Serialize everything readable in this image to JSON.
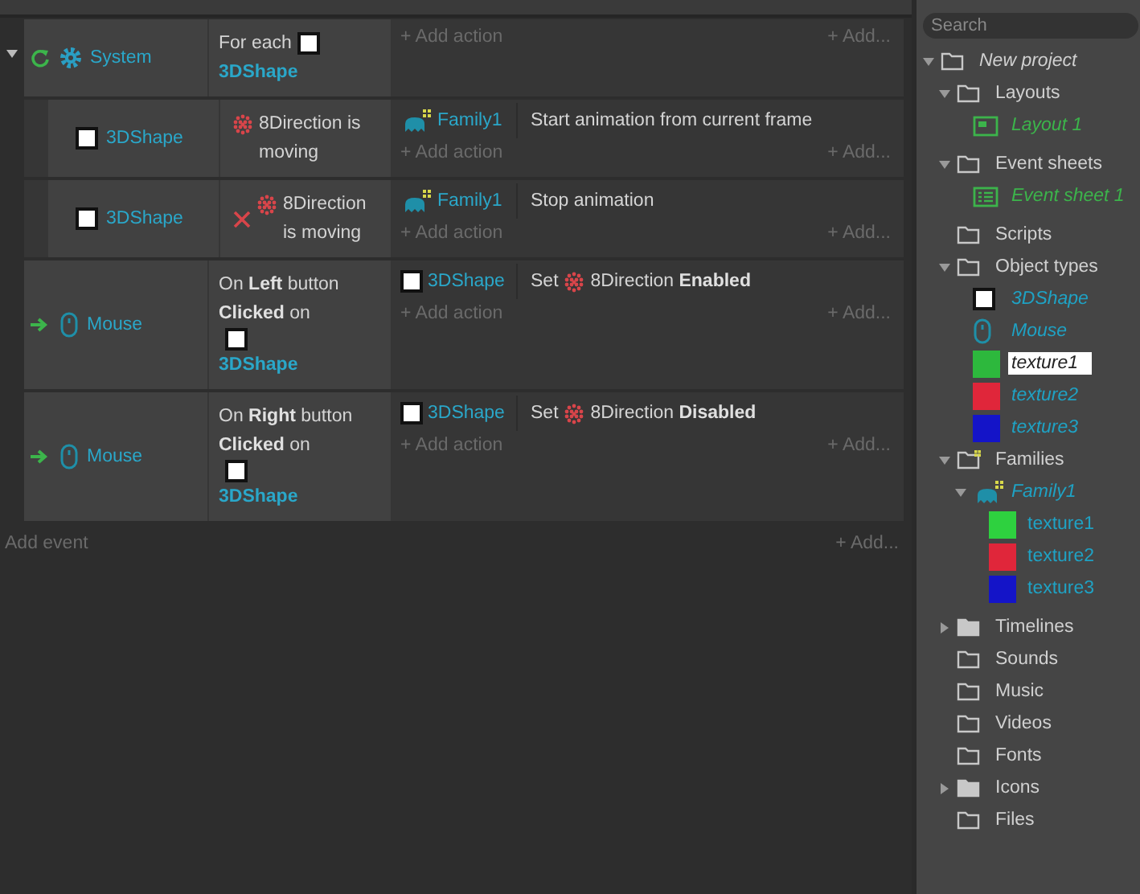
{
  "events": [
    {
      "kind": "loop",
      "expanded": true,
      "object": {
        "kind": "system",
        "name": "System"
      },
      "condition": {
        "inverted": false,
        "segments": [
          {
            "kind": "text",
            "text": "For each"
          },
          {
            "kind": "object",
            "name": "3DShape"
          }
        ]
      },
      "add_action": "+ Add action",
      "add_more": "+ Add...",
      "children": [
        {
          "object": {
            "kind": "shape",
            "name": "3DShape"
          },
          "condition": {
            "inverted": false,
            "segments": [
              {
                "kind": "behavior",
                "text": "8Direction is moving"
              }
            ]
          },
          "actions": [
            {
              "object": {
                "kind": "family",
                "name": "Family1"
              },
              "segments": [
                {
                  "kind": "text",
                  "text": "Start animation from current frame"
                }
              ]
            }
          ],
          "add_action": "+ Add action",
          "add_more": "+ Add..."
        },
        {
          "object": {
            "kind": "shape",
            "name": "3DShape"
          },
          "condition": {
            "inverted": true,
            "segments": [
              {
                "kind": "behavior",
                "text": "8Direction is moving"
              }
            ]
          },
          "actions": [
            {
              "object": {
                "kind": "family",
                "name": "Family1"
              },
              "segments": [
                {
                  "kind": "text",
                  "text": "Stop animation"
                }
              ]
            }
          ],
          "add_action": "+ Add action",
          "add_more": "+ Add..."
        }
      ]
    },
    {
      "kind": "trigger",
      "object": {
        "kind": "mouse",
        "name": "Mouse"
      },
      "condition": {
        "inverted": false,
        "segments": [
          {
            "kind": "text",
            "text": "On **Left** button **Clicked** on"
          },
          {
            "kind": "object",
            "name": "3DShape"
          }
        ]
      },
      "actions": [
        {
          "object": {
            "kind": "shape",
            "name": "3DShape"
          },
          "segments": [
            {
              "kind": "text",
              "text": "Set"
            },
            {
              "kind": "behavior",
              "text": "8Direction **Enabled**"
            }
          ]
        }
      ],
      "add_action": "+ Add action",
      "add_more": "+ Add..."
    },
    {
      "kind": "trigger",
      "object": {
        "kind": "mouse",
        "name": "Mouse"
      },
      "condition": {
        "inverted": false,
        "segments": [
          {
            "kind": "text",
            "text": "On **Right** button **Clicked** on"
          },
          {
            "kind": "object",
            "name": "3DShape"
          }
        ]
      },
      "actions": [
        {
          "object": {
            "kind": "shape",
            "name": "3DShape"
          },
          "segments": [
            {
              "kind": "text",
              "text": "Set"
            },
            {
              "kind": "behavior",
              "text": "8Direction **Disabled**"
            }
          ]
        }
      ],
      "add_action": "+ Add action",
      "add_more": "+ Add..."
    }
  ],
  "footer": {
    "add_event": "Add event",
    "add_more": "+ Add..."
  },
  "project_bar": {
    "search": {
      "placeholder": "Search"
    },
    "tree": [
      {
        "label": "New project",
        "kind": "project",
        "expanded": true,
        "selected": false,
        "children": [
          {
            "label": "Layouts",
            "kind": "folder",
            "expanded": true,
            "selected": false,
            "children": [
              {
                "label": "Layout 1",
                "kind": "layout",
                "selected": false
              }
            ]
          },
          {
            "label": "Event sheets",
            "kind": "folder",
            "expanded": true,
            "selected": false,
            "children": [
              {
                "label": "Event sheet 1",
                "kind": "eventsheet",
                "selected": false
              }
            ]
          },
          {
            "label": "Scripts",
            "kind": "folder",
            "selected": false
          },
          {
            "label": "Object types",
            "kind": "folder",
            "expanded": true,
            "selected": false,
            "children": [
              {
                "label": "3DShape",
                "kind": "shape",
                "selected": false
              },
              {
                "label": "Mouse",
                "kind": "mouse",
                "selected": false
              },
              {
                "label": "texture1",
                "kind": "swatch",
                "color": "#2db83d",
                "selected": true
              },
              {
                "label": "texture2",
                "kind": "swatch",
                "color": "#e0263a",
                "selected": false
              },
              {
                "label": "texture3",
                "kind": "swatch",
                "color": "#1414c8",
                "selected": false
              }
            ]
          },
          {
            "label": "Families",
            "kind": "families",
            "expanded": true,
            "selected": false,
            "children": [
              {
                "label": "Family1",
                "kind": "family",
                "expanded": true,
                "selected": false,
                "children": [
                  {
                    "label": "texture1",
                    "kind": "member",
                    "color": "#2ed13f",
                    "selected": false
                  },
                  {
                    "label": "texture2",
                    "kind": "member",
                    "color": "#e0263a",
                    "selected": false
                  },
                  {
                    "label": "texture3",
                    "kind": "member",
                    "color": "#1414c8",
                    "selected": false
                  }
                ]
              }
            ]
          },
          {
            "label": "Timelines",
            "kind": "folder",
            "expanded": false,
            "selected": false
          },
          {
            "label": "Sounds",
            "kind": "folder",
            "selected": false
          },
          {
            "label": "Music",
            "kind": "folder",
            "selected": false
          },
          {
            "label": "Videos",
            "kind": "folder",
            "selected": false
          },
          {
            "label": "Fonts",
            "kind": "folder",
            "selected": false
          },
          {
            "label": "Icons",
            "kind": "folder",
            "expanded": false,
            "selected": false
          },
          {
            "label": "Files",
            "kind": "folder",
            "selected": false
          }
        ]
      }
    ]
  }
}
